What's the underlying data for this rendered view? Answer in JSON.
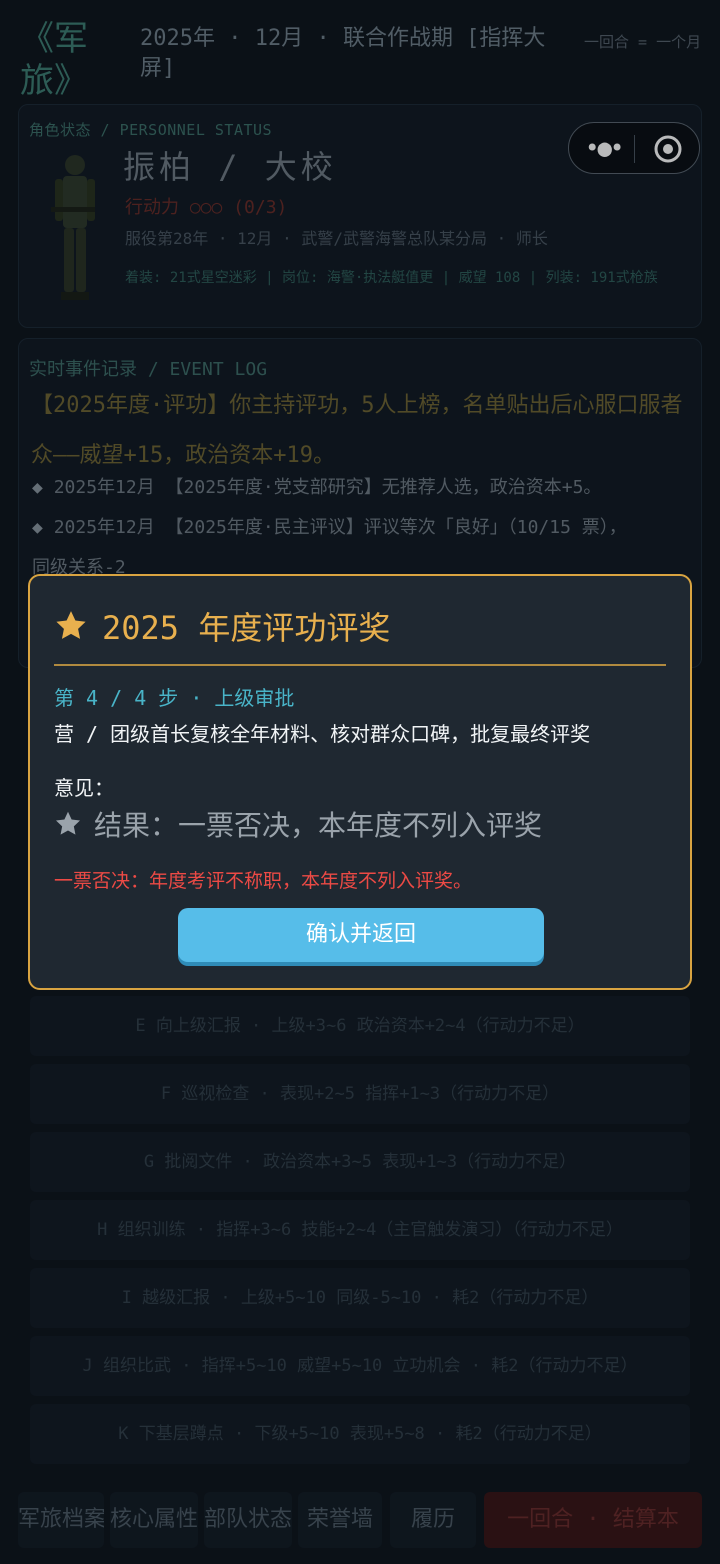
{
  "header": {
    "logo": "《军旅》",
    "period": "2025年 · 12月 · 联合作战期 [指挥大屏]",
    "turn_info": "一回合 = 一个月"
  },
  "status": {
    "label": "角色状态 / PERSONNEL STATUS",
    "name_rank": "振柏 / 大校",
    "action_points": "行动力 ○○○ (0/3)",
    "service": "服役第28年 · 12月 · 武警/武警海警总队某分局 · 师长",
    "gear": "着装: 21式星空迷彩 | 岗位: 海警·执法艇值更 | 威望 108 | 列装: 191式枪族"
  },
  "events": {
    "title": "实时事件记录 / EVENT LOG",
    "main": "【2025年度·评功】你主持评功，5人上榜，名单贴出后心服口服者众——威望+15，政治资本+19。",
    "items": [
      "2025年12月 【2025年度·党支部研究】无推荐人选，政治资本+5。",
      "2025年12月 【2025年度·民主评议】评议等次「良好」（10/15 票），",
      "同级关系-2"
    ]
  },
  "actions": [
    "E 向上级汇报 · 上级+3~6 政治资本+2~4（行动力不足）",
    "F 巡视检查 · 表现+2~5 指挥+1~3（行动力不足）",
    "G 批阅文件 · 政治资本+3~5 表现+1~3（行动力不足）",
    "H 组织训练 · 指挥+3~6 技能+2~4（主官触发演习）（行动力不足）",
    "I 越级汇报 · 上级+5~10 同级-5~10 · 耗2（行动力不足）",
    "J 组织比武 · 指挥+5~10 威望+5~10 立功机会 · 耗2（行动力不足）",
    "K 下基层蹲点 · 下级+5~10 表现+5~8 · 耗2（行动力不足）"
  ],
  "nav": {
    "archive": "军旅档案",
    "attributes": "核心属性",
    "troops": "部队状态",
    "honors": "荣誉墙",
    "resume": "履历",
    "end_turn": "一回合 · 结算本"
  },
  "modal": {
    "title": "2025 年度评功评奖",
    "step": "第 4 / 4 步 · 上级审批",
    "description": "营 / 团级首长复核全年材料、核对群众口碑，批复最终评奖",
    "opinion_label": "意见：",
    "result": "结果：一票否决，本年度不列入评奖",
    "veto_note": "一票否决：年度考评不称职，本年度不列入评奖。",
    "confirm_button": "确认并返回"
  },
  "colors": {
    "accent_gold": "#d9a441",
    "confirm_blue": "#56bde9",
    "veto_red": "#ec4a45",
    "step_teal": "#49b4c8"
  },
  "icons": {
    "title_star": "star-icon",
    "result_star": "star-icon",
    "more": "more-dots-icon",
    "close_target": "target-icon"
  }
}
